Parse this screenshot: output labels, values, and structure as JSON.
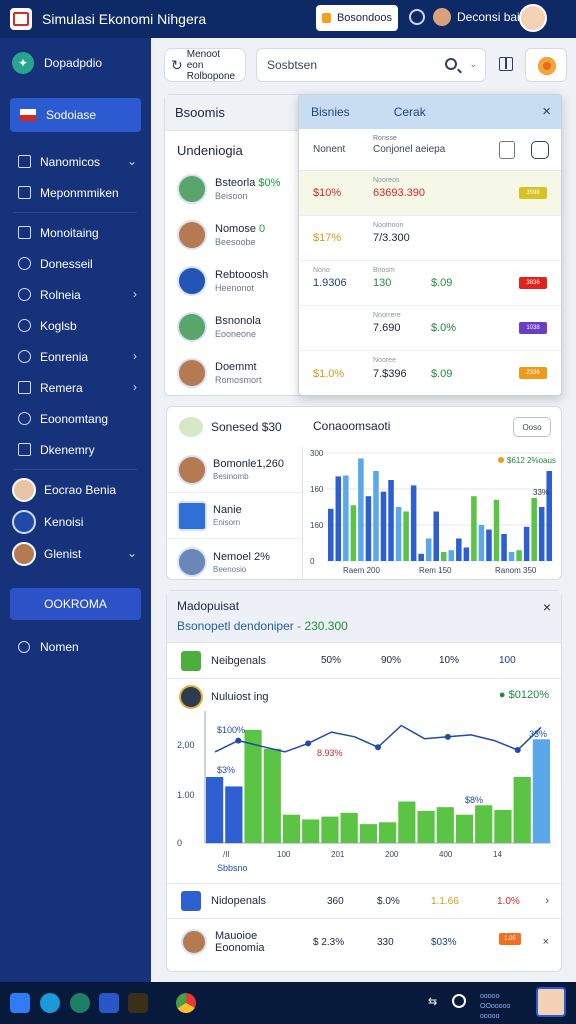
{
  "titlebar": {
    "app_title": "Simulasi Ekonomi Nihgera",
    "button_label": "Bosondoos",
    "user_name": "Deconsi bai"
  },
  "sidebar": {
    "brand": "Dopadpdio",
    "active_item": "Sodoiase",
    "items": [
      {
        "label": "Nanomicos",
        "icon": "wallet-icon",
        "chevron": true
      },
      {
        "label": "Meponmmiken",
        "icon": "home-icon",
        "chevron": false
      },
      {
        "label": "Monoitaing",
        "icon": "table-icon",
        "chevron": false
      },
      {
        "label": "Donesseil",
        "icon": "gear-icon",
        "chevron": false
      },
      {
        "label": "Rolneia",
        "icon": "globe-icon",
        "chevron": true
      },
      {
        "label": "Koglsb",
        "icon": "settings-icon",
        "chevron": false
      },
      {
        "label": "Eonrenia",
        "icon": "chart-icon",
        "chevron": true
      },
      {
        "label": "Remera",
        "icon": "tag-icon",
        "chevron": true
      },
      {
        "label": "Eoonomtang",
        "icon": "clock-icon",
        "chevron": false
      },
      {
        "label": "Dkenemry",
        "icon": "list-icon",
        "chevron": false
      }
    ],
    "users": [
      {
        "label": "Eocrao Benia",
        "chevron": false
      },
      {
        "label": "Kenoisi",
        "chevron": false
      },
      {
        "label": "Glenist",
        "chevron": true
      }
    ],
    "button_label": "OOKROMA",
    "footer_label": "Nomen"
  },
  "topbar": {
    "chip_line1": "Menoot eon",
    "chip_line2": "Rolbopone",
    "search_placeholder": "Sosbtsen"
  },
  "card1": {
    "header": "Bsoomis",
    "subheader": "Undeniogia",
    "people": [
      {
        "name": "Bsteorla",
        "value": "$0%",
        "sub": "Beisoon"
      },
      {
        "name": "Nomose",
        "value": "0",
        "sub": "Beesoobe"
      },
      {
        "name": "Rebtooosh",
        "value": "",
        "sub": "Heenonot"
      },
      {
        "name": "Bsnonola",
        "value": "",
        "sub": "Eooneone"
      },
      {
        "name": "Doemmt",
        "value": "",
        "sub": "Romosmort"
      }
    ]
  },
  "popup": {
    "tab1": "Bisnies",
    "tab2": "Cerak",
    "head_col1": "Nonent",
    "head_col2": "Conjonel aeiepa",
    "head_small": "Ronsse",
    "rows": [
      {
        "a": "$10%",
        "b": "63693.390",
        "c": "",
        "small": "Nooreos",
        "badge": "3598",
        "color": "#d8c21f",
        "tone": "red"
      },
      {
        "a": "$17%",
        "b": "7/3.300",
        "c": "",
        "small": "Nootnoon",
        "badge": "",
        "color": "",
        "tone": "dark"
      },
      {
        "a": "1.9306",
        "b": "130",
        "c": "$.09",
        "small": "Bnosm",
        "badge": "3836",
        "color": "#e0241b",
        "tone": "blue"
      },
      {
        "a": "",
        "b": "7.690",
        "c": "$.0%",
        "small": "Nnorrere",
        "badge": "1038",
        "color": "#6b3fc2",
        "tone": "dark"
      },
      {
        "a": "$1.0%",
        "b": "7.$396",
        "c": "$.09",
        "small": "Nooree",
        "badge": "2336",
        "color": "#ef9a1b",
        "tone": "yellow"
      }
    ]
  },
  "card2": {
    "title": "Sonesed $30",
    "title2": "Conaoomsaoti",
    "pill": "Ooso",
    "people": [
      {
        "name": "Bomonle1,260",
        "sub": "Besinomb"
      },
      {
        "name": "Nanie",
        "sub": "Enisorn"
      },
      {
        "name": "Nemoel 2%",
        "sub": "Beenosio"
      }
    ],
    "legend": "$612 2%oaus",
    "max_label": "33%"
  },
  "card3": {
    "title": "Madopuisat",
    "subtitle": "Bsonopetl dendoniper",
    "subtitle_value": "- 230.300",
    "table_header": {
      "label": "Neibgenals",
      "c1": "50%",
      "c2": "90%",
      "c3": "10%",
      "c4": "100"
    },
    "legend_row": {
      "label": "Nuluiost ing",
      "value": "$0120%"
    },
    "footer_rows": [
      {
        "label": "Nidopenals",
        "c1": "360",
        "c2": "$.0%",
        "c3": "1.1.66",
        "c4": "1.0%"
      },
      {
        "label": "Mauoioe Eoonomia",
        "c1": "$ 2.3%",
        "c2": "330",
        "c3": "$03%",
        "badge": "1.05"
      }
    ]
  },
  "chart_data": [
    {
      "type": "bar",
      "y_ticks": [
        "300",
        "160",
        "160",
        "0"
      ],
      "x_ticks": [
        "Raem 200",
        "Rem 150",
        "Ranom 350"
      ],
      "series_note": "mixed blue, light-blue and green bars",
      "values": [
        58,
        94,
        95,
        62,
        114,
        72,
        100,
        77,
        90,
        60,
        55,
        84,
        8,
        25,
        55,
        10,
        12,
        25,
        15,
        72,
        40,
        35,
        68,
        30,
        10,
        12,
        38,
        70,
        60,
        100
      ],
      "colors": [
        "blue",
        "blue",
        "lightblue",
        "green",
        "lightblue",
        "blue",
        "lightblue",
        "blue",
        "blue",
        "lightblue",
        "green",
        "blue",
        "blue",
        "lightblue",
        "blue",
        "green",
        "lightblue",
        "blue",
        "blue",
        "green",
        "lightblue",
        "blue",
        "green",
        "blue",
        "lightblue",
        "green",
        "blue",
        "green",
        "blue",
        "blue"
      ]
    },
    {
      "type": "bar+line",
      "y_ticks": [
        "2,00",
        "1.00",
        "0"
      ],
      "x_ticks": [
        "/II",
        "100",
        "201",
        "200",
        "400",
        "14"
      ],
      "legend_label": "Sbbsno",
      "annotations": [
        "$100%",
        "$3%",
        "8.93%",
        "$8%",
        "33%"
      ],
      "bar_values": [
        70,
        60,
        120,
        100,
        30,
        25,
        28,
        32,
        20,
        22,
        44,
        34,
        38,
        30,
        40,
        35,
        70,
        110
      ],
      "line_values": [
        86,
        98,
        92,
        86,
        95,
        107,
        102,
        91,
        114,
        100,
        102,
        104,
        98,
        88,
        112
      ]
    }
  ],
  "colors": {
    "sidebar": "#15327a",
    "accent": "#2c5bd1",
    "green": "#4caf3d"
  }
}
